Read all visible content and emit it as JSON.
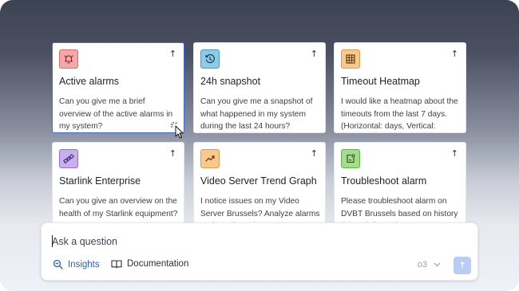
{
  "cards": [
    {
      "title": "Active alarms",
      "desc": "Can you give me a brief overview of the active alarms in my system?",
      "icon": "alarm-bell-icon",
      "icon_bg": "#f6a8a8",
      "icon_border": "#e06868"
    },
    {
      "title": "24h snapshot",
      "desc": "Can you give me a snapshot of what happened in my system during the last 24 hours?",
      "icon": "history-clock-icon",
      "icon_bg": "#8fcbe8",
      "icon_border": "#4a9ac4"
    },
    {
      "title": "Timeout Heatmap",
      "desc": "I would like a heatmap about the timeouts from the last 7 days. (Horizontal: days, Vertical: hours)",
      "icon": "grid-heatmap-icon",
      "icon_bg": "#f8c98e",
      "icon_border": "#e09a4a"
    },
    {
      "title": "Starlink Enterprise",
      "desc": "Can you give an overview on the health of my Starlink equipment?",
      "icon": "satellite-icon",
      "icon_bg": "#c8b0f0",
      "icon_border": "#9070d0"
    },
    {
      "title": "Video Server Trend Graph",
      "desc": "I notice issues on my Video Server Brussels? Analyze alarms and trend graphs.",
      "icon": "trend-chart-icon",
      "icon_bg": "#f8c98e",
      "icon_border": "#e09a4a"
    },
    {
      "title": "Troubleshoot alarm",
      "desc": "Please troubleshoot alarm on DVBT Brussels based on history tickets information.",
      "icon": "troubleshoot-icon",
      "icon_bg": "#a6dc8e",
      "icon_border": "#62b046"
    }
  ],
  "arrow": "↑",
  "ask": {
    "placeholder": "Ask a question",
    "insights_label": "Insights",
    "docs_label": "Documentation",
    "model": "o3",
    "send_icon": "↑"
  },
  "colors": {
    "accent": "#2a5fc4",
    "active_border": "#3b6fd6"
  }
}
